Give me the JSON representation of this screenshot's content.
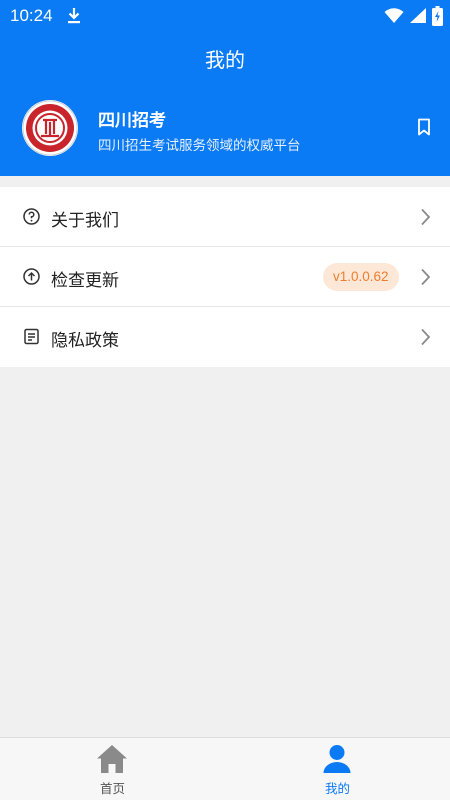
{
  "status_bar": {
    "time": "10:24"
  },
  "header": {
    "title": "我的"
  },
  "profile": {
    "name": "四川招考",
    "description": "四川招生考试服务领域的权威平台"
  },
  "menu": {
    "items": [
      {
        "label": "关于我们",
        "icon": "question-circle-icon"
      },
      {
        "label": "检查更新",
        "icon": "arrow-up-circle-icon",
        "badge": "v1.0.0.62"
      },
      {
        "label": "隐私政策",
        "icon": "document-icon"
      }
    ]
  },
  "tabbar": {
    "tabs": [
      {
        "label": "首页",
        "icon": "home-icon",
        "active": false
      },
      {
        "label": "我的",
        "icon": "user-icon",
        "active": true
      }
    ]
  },
  "colors": {
    "primary": "#0a7af5",
    "badge_bg": "#fde8d7",
    "badge_text": "#ef7d2d",
    "page_bg": "#f0f0f0"
  }
}
